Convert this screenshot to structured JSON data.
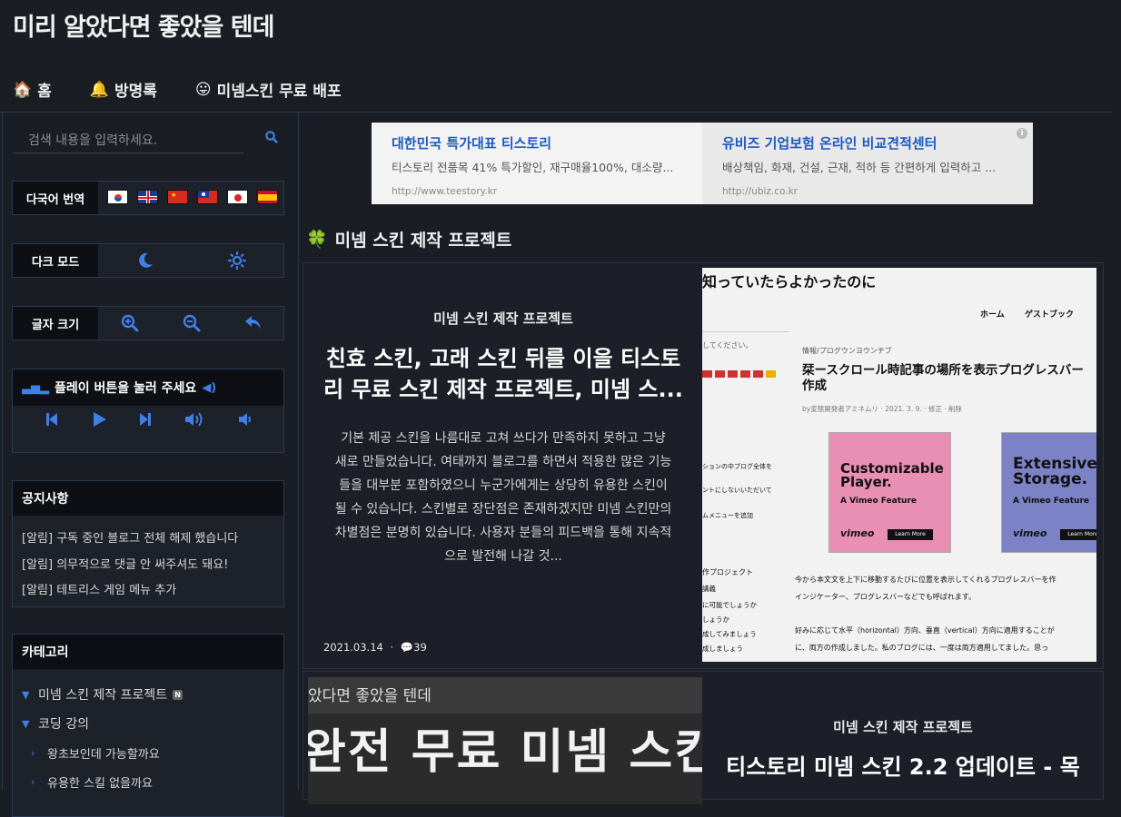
{
  "site": {
    "title": "미리 알았다면 좋았을 텐데"
  },
  "nav": [
    {
      "icon": "🏠",
      "label": "홈"
    },
    {
      "icon": "🔔",
      "label": "방명록"
    },
    {
      "icon": "😛",
      "label": "미넴스킨 무료 배포"
    }
  ],
  "sidebar": {
    "search_placeholder": "검색 내용을 입력하세요.",
    "translate_label": "다국어 번역",
    "darkmode_label": "다크 모드",
    "fontsize_label": "글자 크기",
    "player_label": "플레이 버튼을 눌러 주세요",
    "notice": {
      "title": "공지사항",
      "items": [
        "[알림] 구독 중인 블로그 전체 해제 했습니다",
        "[알림] 의무적으로 댓글 안 써주셔도 돼요!",
        "[알림] 테트리스 게임 메뉴 추가"
      ]
    },
    "category": {
      "title": "카테고리",
      "items": [
        "미넴 스킨 제작 프로젝트",
        "코딩 강의",
        "왕초보인데 가능할까요",
        "유용한 스킬 없을까요"
      ],
      "new_badge": "N"
    }
  },
  "ads": [
    {
      "title": "대한민국 특가대표 티스토리",
      "desc": "티스토리 전품목 41% 특가할인, 재구매율100%, 대소량...",
      "url": "http://www.teestory.kr"
    },
    {
      "title": "유비즈 기업보험 온라인 비교견적센터",
      "desc": "배상책임, 화재, 건설, 근재, 적하 등 간편하게 입력하고 ...",
      "url": "http://ubiz.co.kr"
    }
  ],
  "section": {
    "icon": "🍀",
    "title": "미넴 스킨 제작 프로젝트"
  },
  "posts": [
    {
      "category": "미넴 스킨 제작 프로젝트",
      "title_line1": "친효 스킨, 고래 스킨 뒤를 이을 티스토",
      "title_line2": "리 무료 스킨 제작 프로젝트, 미넴 스...",
      "body": "기본 제공 스킨을 나름대로 고쳐 쓰다가 만족하지 못하고 그냥 새로 만들었습니다. 여태까지 블로그를 하면서 적용한 많은 기능들을 대부분 포함하였으니 누군가에게는 상당히 유용한 스킨이 될 수 있습니다. 스킨별로 장단점은 존재하겠지만 미넴 스킨만의 차별점은 분명히 있습니다. 사용자 분들의 피드백을 통해 지속적으로 발전해 나갈 것...",
      "date": "2021.03.14",
      "comments": "39",
      "thumb": {
        "heading": "知っていたらよかったのに",
        "menu1": "ホーム",
        "menu2": "ゲストブック",
        "search_ph": "してください。",
        "crumb": "情報/プログウンヨウンチブ",
        "title": "栞ースクロール時記事の場所を表示プログレスバー作成",
        "meta": "by変態開発者アミネムリ · 2021. 3. 9. · 修正 · 削除",
        "ad1_title": "Customizable Player.",
        "ad1_sub": "A Vimeo Feature",
        "ad2_title": "Extensive Storage.",
        "ad2_sub": "A Vimeo Feature",
        "brand": "vimeo",
        "learn": "Learn More",
        "side1": "ションの中ブログ全体を",
        "side2": "ントにしないいただいて",
        "side3": "ムメニューを追加",
        "side4": "作プロジェクト",
        "side5": "講義",
        "side6": "に可能でしょうか",
        "side7": "しょうか",
        "side8": "成してみましょう",
        "side9": "成しましょう",
        "para1": "今から本文文を上下に移動するたびに位置を表示してくれるプログレスバーを作",
        "para2": "インジケーター、プログレスバーなどでも呼ばれます。",
        "para3": "好みに応じて水平（horizontal）方向、垂直（vertical）方向に適用することが",
        "para4": "に、両方の作成しました。私のブログには、一度は両方適用してました。思っ"
      }
    },
    {
      "category": "미넴 스킨 제작 프로젝트",
      "title": "티스토리 미넴 스킨 2.2 업데이트 - 목",
      "thumb": {
        "small": "았다면 좋았을 텐데",
        "big": "완전 무료 미넴 스킨"
      }
    }
  ],
  "colors": {
    "accent": "#3f7fe6",
    "bg": "#1a1d23",
    "card": "#1c1f27"
  }
}
